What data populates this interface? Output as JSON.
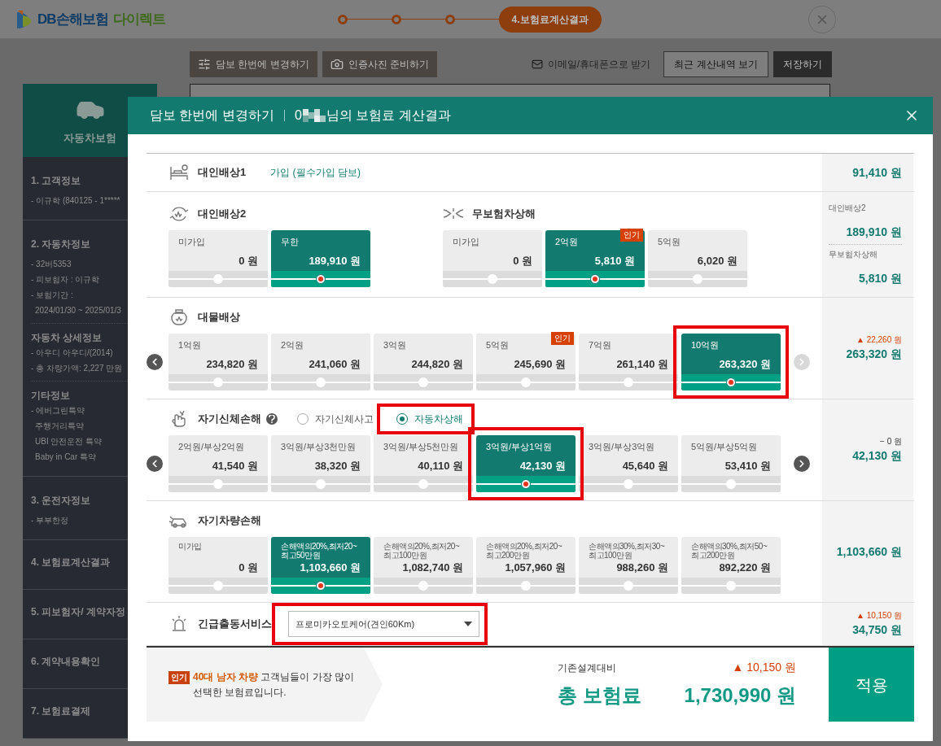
{
  "header": {
    "logo_brand": "DB손해보험",
    "logo_suffix": "다이렉트",
    "steps": [
      {
        "kind": "dot"
      },
      {
        "kind": "dot"
      },
      {
        "kind": "dot"
      },
      {
        "kind": "pill",
        "label": "4.보험료계산결과"
      }
    ]
  },
  "toolbar": {
    "left_buttons": [
      "담보 한번에 변경하기",
      "인증사진 준비하기"
    ],
    "email_link": "이메일/휴대폰으로 받기",
    "history_button": "최근 계산내역 보기",
    "save_button": "저장하기"
  },
  "sidebar": {
    "title": "자동차보험",
    "sections": [
      {
        "heading": "1. 고객정보",
        "lines": [
          {
            "text": "- 이규학 (840125 - 1*****"
          }
        ]
      },
      {
        "heading": "2. 자동차정보",
        "lines": [
          {
            "text": "- 32버5353"
          },
          {
            "text": "- 피보험자 : 이규학"
          },
          {
            "text": "- 보험기간 :",
            "children": [
              {
                "text": "2024/01/30 ~ 2025/01/3"
              }
            ]
          }
        ],
        "subsections": [
          {
            "heading": "자동차 상세정보",
            "lines": [
              {
                "text": "- 아우디 아우디/(2014)"
              },
              {
                "text": "- 총 차량가액: 2,227 만원"
              }
            ]
          },
          {
            "heading": "기타정보",
            "lines": [
              {
                "text": "- 에버그린특약",
                "children": [
                  {
                    "text": "주행거리특약"
                  },
                  {
                    "text": "UBI 안전운전 특약"
                  },
                  {
                    "text": "Baby in Car 특약"
                  }
                ]
              }
            ]
          }
        ]
      },
      {
        "heading": "3. 운전자정보",
        "lines": [
          {
            "text": "- 부부한정"
          }
        ]
      },
      {
        "heading": "4. 보험료계산결과"
      },
      {
        "heading": "5. 피보험자/ 계약자정"
      },
      {
        "heading": "6. 계약내용확인"
      },
      {
        "heading": "7. 보험료결제"
      }
    ]
  },
  "modal": {
    "title": "담보 한번에 변경하기",
    "subtitle_prefix": "0",
    "subtitle_suffix": "님의 보험료 계산결과",
    "sections": [
      {
        "kind": "fixed",
        "groups": [
          {
            "title": "대인배상1",
            "note": "가입 (필수가입 담보)"
          }
        ],
        "summary": [
          {
            "amount": "91,410 원"
          }
        ]
      },
      {
        "kind": "options",
        "groups": [
          {
            "title": "대인배상2",
            "options": [
              {
                "label": "미가입",
                "price": "0 원",
                "selected": false,
                "highlighted": false
              },
              {
                "label": "무한",
                "price": "189,910 원",
                "selected": true,
                "highlighted": false
              }
            ]
          },
          {
            "title": "무보험차상해",
            "options": [
              {
                "label": "미가입",
                "price": "0 원",
                "selected": false,
                "highlighted": false
              },
              {
                "label": "2억원",
                "price": "5,810 원",
                "selected": true,
                "highlighted": false,
                "badge": "인기"
              },
              {
                "label": "5억원",
                "price": "6,020 원",
                "selected": false,
                "highlighted": false
              }
            ]
          }
        ],
        "summary": [
          {
            "label": "대인배상2",
            "amount": "189,910 원"
          },
          {
            "label": "무보험차상해",
            "amount": "5,810 원"
          }
        ]
      },
      {
        "kind": "options",
        "nav": {
          "prev_disabled": false,
          "next_disabled": true
        },
        "groups": [
          {
            "title": "대물배상",
            "options": [
              {
                "label": "1억원",
                "price": "234,820 원",
                "selected": false,
                "highlighted": false
              },
              {
                "label": "2억원",
                "price": "241,060 원",
                "selected": false,
                "highlighted": false
              },
              {
                "label": "3억원",
                "price": "244,820 원",
                "selected": false,
                "highlighted": false
              },
              {
                "label": "5억원",
                "price": "245,690 원",
                "selected": false,
                "highlighted": false,
                "badge": "인기"
              },
              {
                "label": "7억원",
                "price": "261,140 원",
                "selected": false,
                "highlighted": false
              },
              {
                "label": "10억원",
                "price": "263,320 원",
                "selected": true,
                "highlighted": true
              }
            ]
          }
        ],
        "summary": [
          {
            "increase": true,
            "delta": "▲ 22,260 원",
            "amount": "263,320 원"
          }
        ]
      },
      {
        "kind": "options",
        "nav": {
          "prev_disabled": false,
          "next_disabled": false
        },
        "groups": [
          {
            "title": "자기신체손해",
            "help": true,
            "radios": [
              {
                "label": "자기신체사고",
                "selected": false,
                "highlighted": false
              },
              {
                "label": "자동차상해",
                "selected": true,
                "highlighted": true
              }
            ],
            "options": [
              {
                "label": "2억원/부상2억원",
                "price": "41,540 원",
                "selected": false,
                "highlighted": false
              },
              {
                "label": "3억원/부상3천만원",
                "price": "38,320 원",
                "selected": false,
                "highlighted": false
              },
              {
                "label": "3억원/부상5천만원",
                "price": "40,110 원",
                "selected": false,
                "highlighted": false
              },
              {
                "label": "3억원/부상1억원",
                "price": "42,130 원",
                "selected": true,
                "highlighted": true
              },
              {
                "label": "3억원/부상3억원",
                "price": "45,640 원",
                "selected": false,
                "highlighted": false
              },
              {
                "label": "5억원/부상5억원",
                "price": "53,410 원",
                "selected": false,
                "highlighted": false
              }
            ]
          }
        ],
        "summary": [
          {
            "increase": false,
            "delta": "− 0 원",
            "amount": "42,130 원"
          }
        ]
      },
      {
        "kind": "options",
        "groups": [
          {
            "title": "자기차량손해",
            "options": [
              {
                "label": "미가입",
                "price": "0 원",
                "selected": false,
                "highlighted": false
              },
              {
                "label": "손해액의20%,최저20~최고50만원",
                "price": "1,103,660 원",
                "selected": true,
                "highlighted": false
              },
              {
                "label": "손해액의20%,최저20~최고100만원",
                "price": "1,082,740 원",
                "selected": false,
                "highlighted": false
              },
              {
                "label": "손해액의20%,최저20~최고200만원",
                "price": "1,057,960 원",
                "selected": false,
                "highlighted": false
              },
              {
                "label": "손해액의30%,최저30~최고100만원",
                "price": "988,260 원",
                "selected": false,
                "highlighted": false
              },
              {
                "label": "손해액의30%,최저50~최고200만원",
                "price": "892,220 원",
                "selected": false,
                "highlighted": false
              }
            ]
          }
        ],
        "summary": [
          {
            "amount": "1,103,660 원"
          }
        ]
      },
      {
        "kind": "select",
        "groups": [
          {
            "title": "긴급출동서비스",
            "select": {
              "value": "프로미카오토케어(견인60Km)",
              "highlighted": true
            }
          }
        ],
        "summary": [
          {
            "increase": true,
            "delta": "▲ 10,150 원",
            "amount": "34,750 원"
          }
        ]
      }
    ],
    "footer": {
      "badge": "인기",
      "highlight": "40대 남자 차량",
      "text": " 고객님들이 가장 많이 선택한 보험료입니다.",
      "compare_label": "기존설계대비",
      "compare_increase": true,
      "compare_delta": "▲ 10,150 원",
      "total_label": "총 보험료",
      "total": "1,730,990 원",
      "apply_button": "적용"
    }
  }
}
